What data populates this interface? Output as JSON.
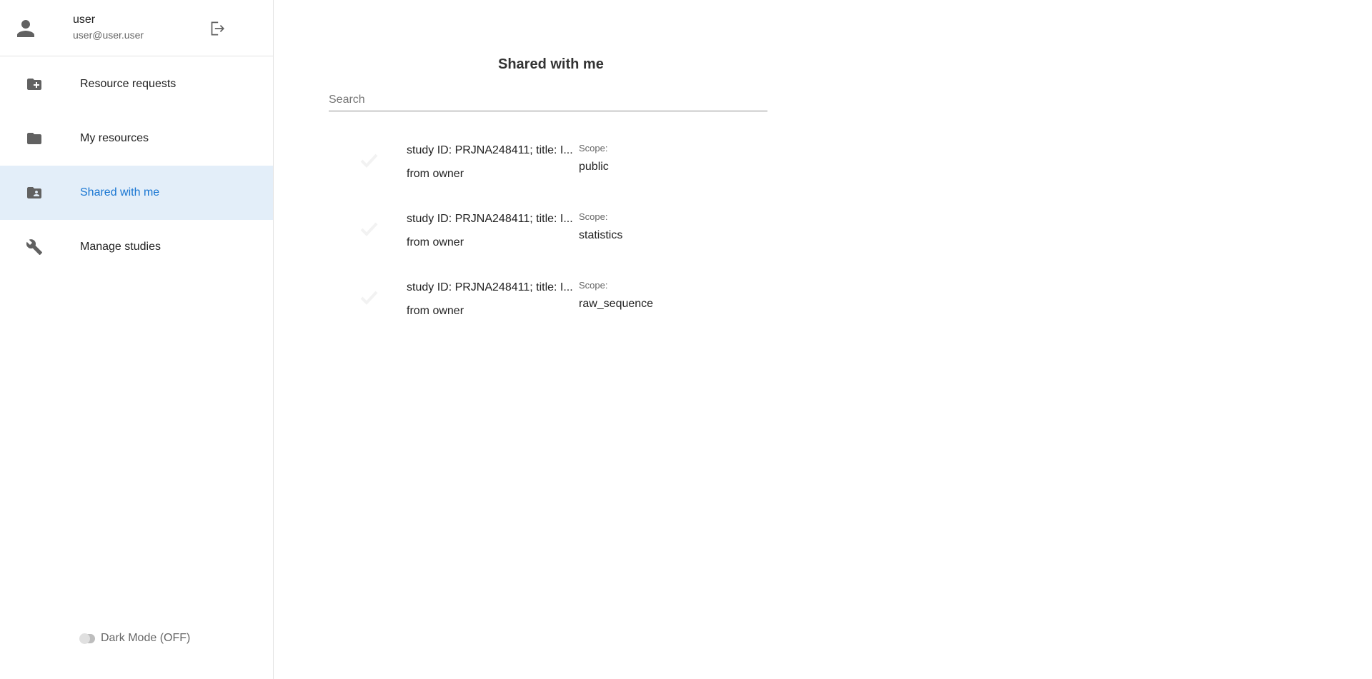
{
  "user": {
    "name": "user",
    "email": "user@user.user",
    "avatar_icon": "person-icon",
    "logout_icon": "logout-icon"
  },
  "nav": {
    "items": [
      {
        "label": "Resource requests",
        "icon": "folder-plus-icon",
        "active": false
      },
      {
        "label": "My resources",
        "icon": "folder-icon",
        "active": false
      },
      {
        "label": "Shared with me",
        "icon": "folder-shared-icon",
        "active": true
      },
      {
        "label": "Manage studies",
        "icon": "wrench-icon",
        "active": false
      }
    ]
  },
  "dark_mode": {
    "label": "Dark Mode (OFF)",
    "on": false
  },
  "main": {
    "title": "Shared with me",
    "search": {
      "placeholder": "Search",
      "value": ""
    },
    "items": [
      {
        "title": "study ID: PRJNA248411; title: I...",
        "owner": "from owner",
        "scope_label": "Scope:",
        "scope": "public"
      },
      {
        "title": "study ID: PRJNA248411; title: I...",
        "owner": "from owner",
        "scope_label": "Scope:",
        "scope": "statistics"
      },
      {
        "title": "study ID: PRJNA248411; title: I...",
        "owner": "from owner",
        "scope_label": "Scope:",
        "scope": "raw_sequence"
      }
    ]
  },
  "colors": {
    "accent": "#1976d2",
    "active_bg": "#e3eef9",
    "icon": "#616161"
  }
}
